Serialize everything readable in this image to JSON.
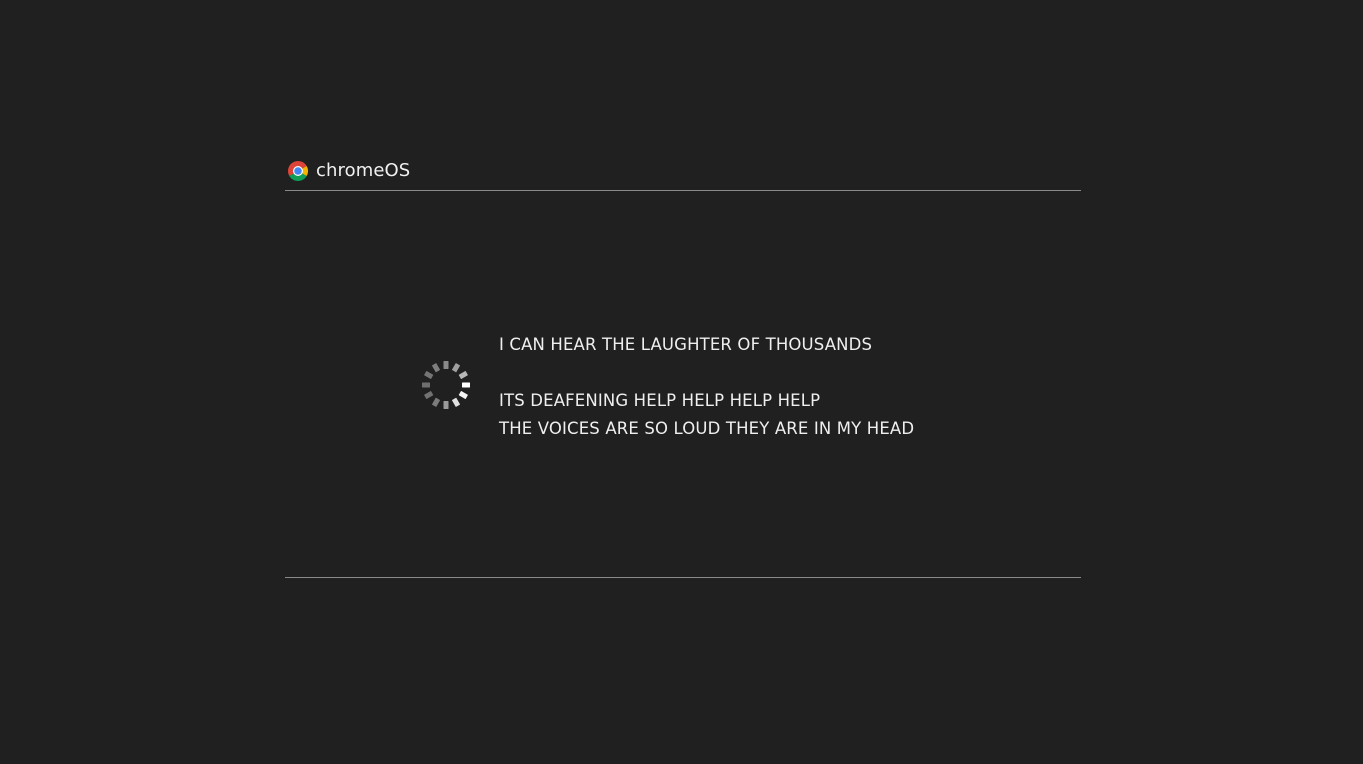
{
  "brand": {
    "icon": "chrome-logo-icon",
    "label": "chromeOS"
  },
  "status": {
    "icon": "loading-spinner-icon"
  },
  "message": {
    "lines": [
      "I CAN HEAR THE LAUGHTER OF THOUSANDS",
      "ITS DEAFENING HELP HELP HELP HELP",
      "THE VOICES ARE SO LOUD THEY ARE IN MY HEAD"
    ]
  },
  "colors": {
    "background": "#202020",
    "text": "#efefef",
    "divider": "#8a8a8a",
    "chrome_red": "#db4437",
    "chrome_yellow": "#f4b400",
    "chrome_green": "#0f9d58",
    "chrome_blue": "#4285f4"
  }
}
